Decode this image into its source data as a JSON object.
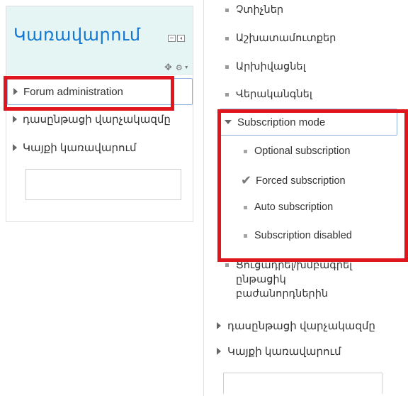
{
  "left_block": {
    "title": "Կառավարում",
    "items": [
      {
        "label": "Forum administration"
      },
      {
        "label": "դասընթացի վարչակազմը"
      },
      {
        "label": "Կայքի կառավարում"
      }
    ],
    "dock_icons": [
      "minimize-icon",
      "dock-left-icon"
    ],
    "action_icons": [
      "move-icon",
      "gear-icon"
    ]
  },
  "right_block": {
    "top_items": [
      {
        "label": "Չտիչներ"
      },
      {
        "label": "Աշխատամուտքեր"
      },
      {
        "label": "Արխիվացնել"
      },
      {
        "label": "Վերականգնել"
      }
    ],
    "subscription_mode": {
      "label": "Subscription mode",
      "options": [
        {
          "label": "Optional subscription",
          "selected": false
        },
        {
          "label": "Forced subscription",
          "selected": true
        },
        {
          "label": "Auto subscription",
          "selected": false
        },
        {
          "label": "Subscription disabled",
          "selected": false
        }
      ]
    },
    "after_item": {
      "label": "Ցուցադրել/խմբագրել ընթացիկ բաժանորդներին"
    },
    "bottom_items": [
      {
        "label": "դասընթացի վարչակազմը"
      },
      {
        "label": "Կայքի կառավարում"
      }
    ]
  },
  "colors": {
    "highlight_red": "#e0161e",
    "title_blue": "#1177d1",
    "header_bg": "#e4f5f4",
    "focus_border": "#8fb0d8"
  }
}
